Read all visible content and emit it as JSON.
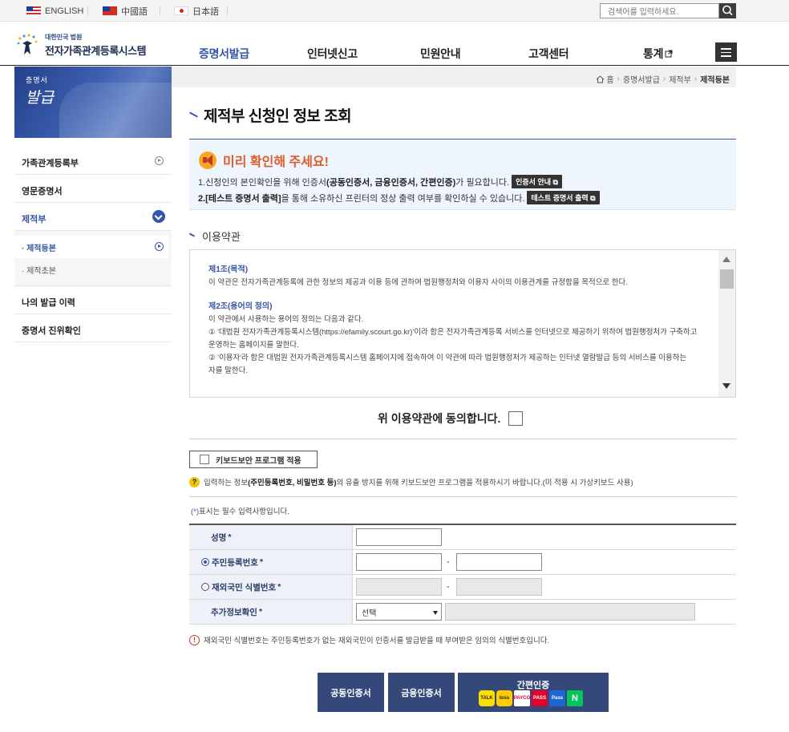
{
  "languages": [
    {
      "label": "ENGLISH",
      "flag": "us-flag-icon"
    },
    {
      "label": "中國語",
      "flag": "taiwan-flag-icon"
    },
    {
      "label": "日本語",
      "flag": "japan-flag-icon"
    }
  ],
  "search": {
    "placeholder": "검색어를 입력하세요."
  },
  "logo": {
    "small": "대한민국 법원",
    "big": "전자가족관계등록시스템"
  },
  "gnb": [
    "증명서발급",
    "인터넷신고",
    "민원안내",
    "고객센터",
    "통계"
  ],
  "gnb_active_index": 0,
  "lnb_banner": {
    "line1": "증명서",
    "line2": "발급"
  },
  "lnb": {
    "items": [
      "가족관계등록부",
      "영문증명서",
      "제적부",
      "나의 발급 이력",
      "증명서 진위확인"
    ],
    "sub_items": [
      "· 제적등본",
      "· 제적초본"
    ]
  },
  "breadcrumb": {
    "home": "홈",
    "level1": "증명서발급",
    "level2": "제적부",
    "current": "제적등본"
  },
  "page_title": "제적부 신청인 정보 조회",
  "notice": {
    "title": "미리 확인해 주세요!",
    "line1_pre": "1.신청인의 본인확인을 위해 인증서",
    "line1_bold": "(공동인증서, 금융인증서, 간편인증)",
    "line1_post": "가 필요합니다.",
    "line1_btn": "인증서 안내",
    "line2_bold": "2.[테스트 증명서 출력]",
    "line2_post": "을 통해 소유하신 프린터의 정상 출력 여부를 확인하실 수 있습니다.",
    "line2_btn": "테스트 증명서 출력"
  },
  "terms": {
    "section_label": "이용약관",
    "art1_title": "제1조(목적)",
    "art1_text": "이 약관은 전자가족관계등록에 관한 정보의 제공과 이용 등에 관하여 법원행정처와 이용자 사이의 이용관계를 규정함을 목적으로 한다.",
    "art2_title": "제2조(용어의 정의)",
    "art2_text": "이 약관에서 사용하는 용어의 정의는 다음과 같다.",
    "art2_1a": "① '대법원 전자가족관계등록시스템(https://efamily.scourt.go.kr)'이라 함은 전자가족관계등록 서비스를 인터넷으로 제공하기 위하여 법원행정처가 구축하고",
    "art2_1b": "운영하는 홈페이지를 말한다.",
    "art2_2a": "② '이용자'라 함은 대법원 전자가족관계등록시스템 홈페이지에 접속하여 이 약관에 따라 법원행정처가 제공하는 인터넷 열람발급 등의 서비스를 이용하는",
    "art2_2b": "자를 말한다."
  },
  "agree_label": "위 이용약관에 동의합니다.",
  "keyboard_button": "키보드보안 프로그램 적용",
  "help": {
    "pre": "입력하는 정보",
    "bold": "(주민등록번호, 비밀번호 등)",
    "post": "의 유출 방지를 위해 키보드보안 프로그램을 적용하시기 바랍니다.(미 적용 시 가상키보드 사용)",
    "icon": "?"
  },
  "required_note": {
    "star": "(*)",
    "text": "표시는 필수 입력사항입니다."
  },
  "form": {
    "name_label": "성명",
    "rrn_label": "주민등록번호",
    "foreign_label": "재외국민 식별번호",
    "extra_label": "추가정보확인",
    "star": "*",
    "dash": "-",
    "select_value": "선택"
  },
  "warning": {
    "icon": "!",
    "text": "재외국민 식별번호는 주민등록번호가 없는 재외국민이 인증서를 발급받을 때 부여받은 임의의 식별번호입니다."
  },
  "buttons": {
    "joint_cert": "공동인증서",
    "financial_cert": "금융인증서",
    "simple_auth": "간편인증"
  },
  "simple_auth_icons": [
    "TALK",
    "toss",
    "PAYCO",
    "PASS",
    "Pass",
    "N"
  ],
  "colors": {
    "primary": "#34487a",
    "accent_blue": "#3555a8",
    "notice_orange": "#e05a2a"
  }
}
